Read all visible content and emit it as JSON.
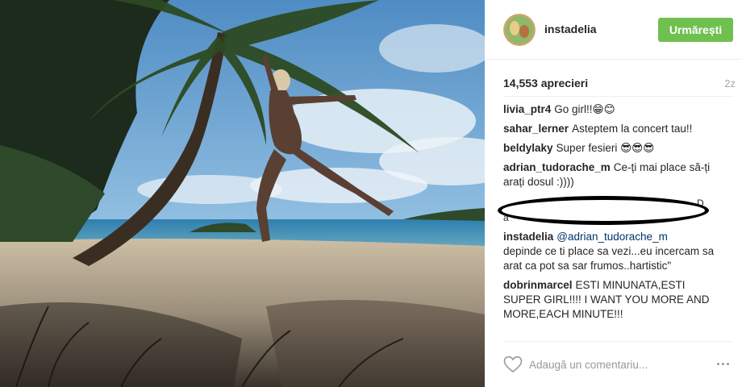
{
  "post": {
    "username": "instadelia",
    "follow_label": "Urmărești",
    "likes": "14,553 aprecieri",
    "time": "2z"
  },
  "comments": [
    {
      "author": "livia_ptr4",
      "text": "Go girl!!😁😊"
    },
    {
      "author": "sahar_lerner",
      "text": "Asteptem la concert tau!!"
    },
    {
      "author": "beldylaky",
      "text": "Super fesieri 😎😎😎"
    },
    {
      "author": "adrian_tudorache_m",
      "text": "Ce-ți mai place să-ți arați dosul :))))"
    },
    {
      "author": "instadelia",
      "mention": "@adrian_tudorache_m",
      "text": "depinde ce ti place sa vezi...eu incercam sa arat ca pot sa sar frumos..hartistic\""
    },
    {
      "author": "dobrinmarcel",
      "text": "ESTI MINUNATA,ESTI SUPER GIRL!!!! I WANT YOU MORE AND MORE,EACH MINUTE!!!"
    }
  ],
  "redacted_residue": [
    "D",
    "a"
  ],
  "comment_box": {
    "placeholder": "Adaugă un comentariu..."
  },
  "colors": {
    "follow": "#70c050",
    "mention": "#003569",
    "redact": "#000000"
  },
  "icons": [
    "heart-icon",
    "more-options-icon",
    "avatar"
  ]
}
